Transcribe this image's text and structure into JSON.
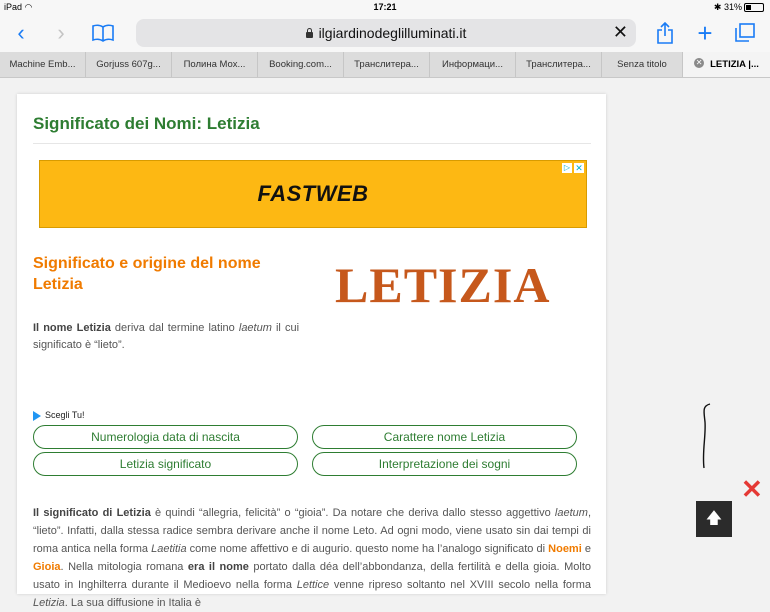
{
  "status": {
    "device": "iPad",
    "time": "17:21",
    "battery": "31%",
    "battery_fraction": 0.31
  },
  "browser": {
    "url": "ilgiardinodeglilluminati.it",
    "tabs": [
      "Machine Emb...",
      "Gorjuss 607g...",
      "Полина Мох...",
      "Booking.com...",
      "Транслитера...",
      "Информаци...",
      "Транслитера...",
      "Senza titolo",
      "LETIZIA |..."
    ]
  },
  "page": {
    "title": "Significato dei Nomi: Letizia",
    "ad_logo": "FASTWEB",
    "section_title": "Significato e origine del nome Letizia",
    "name_display": "LETIZIA",
    "intro": {
      "p1": "Il",
      "p2": "nome Letizia",
      "p3": " deriva dal termine latino ",
      "p4": "laetum",
      "p5": " il cui significato è “lieto”."
    },
    "choose_label": "Scegli Tu!",
    "buttons": [
      "Numerologia data di nascita",
      "Carattere nome Letizia",
      "Letizia significato",
      "Interpretazione dei sogni"
    ],
    "body": {
      "t1": "Il significato di Letizia",
      "t2": " è quindi “allegria, felicità” o “gioia”. Da notare che deriva dallo stesso aggettivo ",
      "t3": "laetum",
      "t4": ", “lieto”. Infatti, dalla stessa radice sembra derivare anche il nome Leto. Ad ogni modo, viene usato sin dai tempi di roma antica nella forma ",
      "t5": "Laetitia",
      "t6": " come nome affettivo e di augurio. questo nome ha l’analogo significato di ",
      "t7": "Noemi",
      "t8": " e ",
      "t9": "Gioia",
      "t10": ". Nella mitologia romana ",
      "t11": "era il nome",
      "t12": " portato dalla déa dell’abbondanza, della fertilità e della gioia. Molto usato in Inghilterra durante il Medioevo nella forma ",
      "t13": "Lettice",
      "t14": " venne ripreso soltanto nel XVIII secolo nella forma ",
      "t15": "Letizia",
      "t16": ". La sua diffusione in Italia è"
    }
  },
  "colors": {
    "green": "#2e7d32",
    "orange": "#f07b00",
    "ad_yellow": "#fdb813",
    "ios_blue": "#1a7cf5"
  }
}
